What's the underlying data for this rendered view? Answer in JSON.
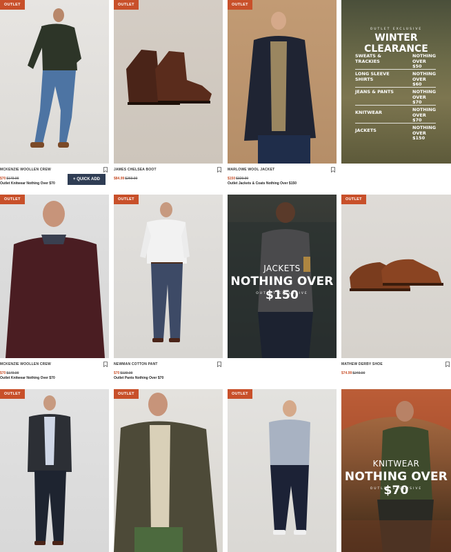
{
  "badge_text": "OUTLET",
  "quick_add_label": "+ QUICK ADD",
  "products": [
    {
      "name": "MCKENZIE WOOLLEN CREW",
      "sale": "$70",
      "was": "$179.99",
      "promo": "Outlet Knitwear Nothing Over $70"
    },
    {
      "name": "JAMES CHELSEA BOOT",
      "sale": "$84.99",
      "was": "$269.99",
      "promo": ""
    },
    {
      "name": "MARLOWE WOOL JACKET",
      "sale": "$150",
      "was": "$329.99",
      "promo": "Outlet Jackets & Coats Nothing Over $150"
    },
    {
      "name": "MCKENZIE WOOLLEN CREW",
      "sale": "$70",
      "was": "$179.99",
      "promo": "Outlet Knitwear Nothing Over $70"
    },
    {
      "name": "NEWMAN COTTON PANT",
      "sale": "$70",
      "was": "$139.99",
      "promo": "Outlet Pants Nothing Over $70"
    },
    {
      "name": "MATHEW DERBY SHOE",
      "sale": "$74.99",
      "was": "$249.99",
      "promo": ""
    }
  ],
  "winter": {
    "eyebrow": "OUTLET EXCLUSIVE",
    "title": "WINTER CLEARANCE",
    "rows": [
      {
        "left": "SWEATS & TRACKIES",
        "right": "NOTHING OVER $50"
      },
      {
        "left": "LONG SLEEVE SHIRTS",
        "right": "NOTHING OVER $60"
      },
      {
        "left": "JEANS & PANTS",
        "right": "NOTHING OVER $70"
      },
      {
        "left": "KNITWEAR",
        "right": "NOTHING OVER $70"
      },
      {
        "left": "JACKETS",
        "right": "NOTHING OVER $150"
      }
    ]
  },
  "jackets_banner": {
    "small": "JACKETS",
    "big": "NOTHING OVER $150",
    "tiny": "OUTLET EXCLUSIVE"
  },
  "knitwear_banner": {
    "small": "KNITWEAR",
    "big": "NOTHING OVER $70",
    "tiny": "OUTLET EXCLUSIVE"
  },
  "colors": {
    "badge": "#c8502a",
    "quick_add": "#2f3d54",
    "sale_price": "#c8502a"
  }
}
